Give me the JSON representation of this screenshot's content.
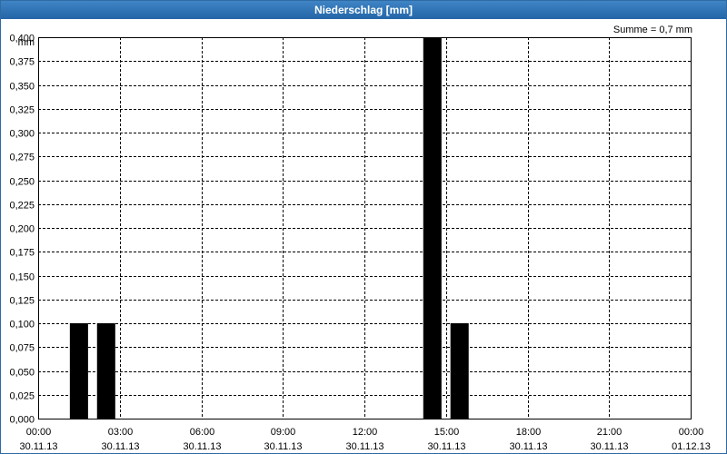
{
  "window": {
    "title": "Niederschlag [mm]"
  },
  "chart_data": {
    "type": "bar",
    "title": "Niederschlag [mm]",
    "ylabel": "mm",
    "annotation": "Summe = 0,7 mm",
    "ylim": [
      0,
      0.4
    ],
    "xlim_hours": [
      0,
      24
    ],
    "y_ticks": [
      "0,000",
      "0,025",
      "0,050",
      "0,075",
      "0,100",
      "0,125",
      "0,150",
      "0,175",
      "0,200",
      "0,225",
      "0,250",
      "0,275",
      "0,300",
      "0,325",
      "0,350",
      "0,375",
      "0,400"
    ],
    "x_ticks": [
      {
        "time": "00:00",
        "date": "30.11.13"
      },
      {
        "time": "03:00",
        "date": "30.11.13"
      },
      {
        "time": "06:00",
        "date": "30.11.13"
      },
      {
        "time": "09:00",
        "date": "30.11.13"
      },
      {
        "time": "12:00",
        "date": "30.11.13"
      },
      {
        "time": "15:00",
        "date": "30.11.13"
      },
      {
        "time": "18:00",
        "date": "30.11.13"
      },
      {
        "time": "21:00",
        "date": "30.11.13"
      },
      {
        "time": "00:00",
        "date": "01.12.13"
      }
    ],
    "bar_width_hours": 0.67,
    "bars": [
      {
        "hour": 1.5,
        "value": 0.1
      },
      {
        "hour": 2.5,
        "value": 0.1
      },
      {
        "hour": 14.5,
        "value": 0.4
      },
      {
        "hour": 15.5,
        "value": 0.1
      }
    ],
    "grid": true,
    "colors": {
      "bar": "#000000",
      "grid": "#000000",
      "title_bg": "#2a6cad"
    }
  }
}
